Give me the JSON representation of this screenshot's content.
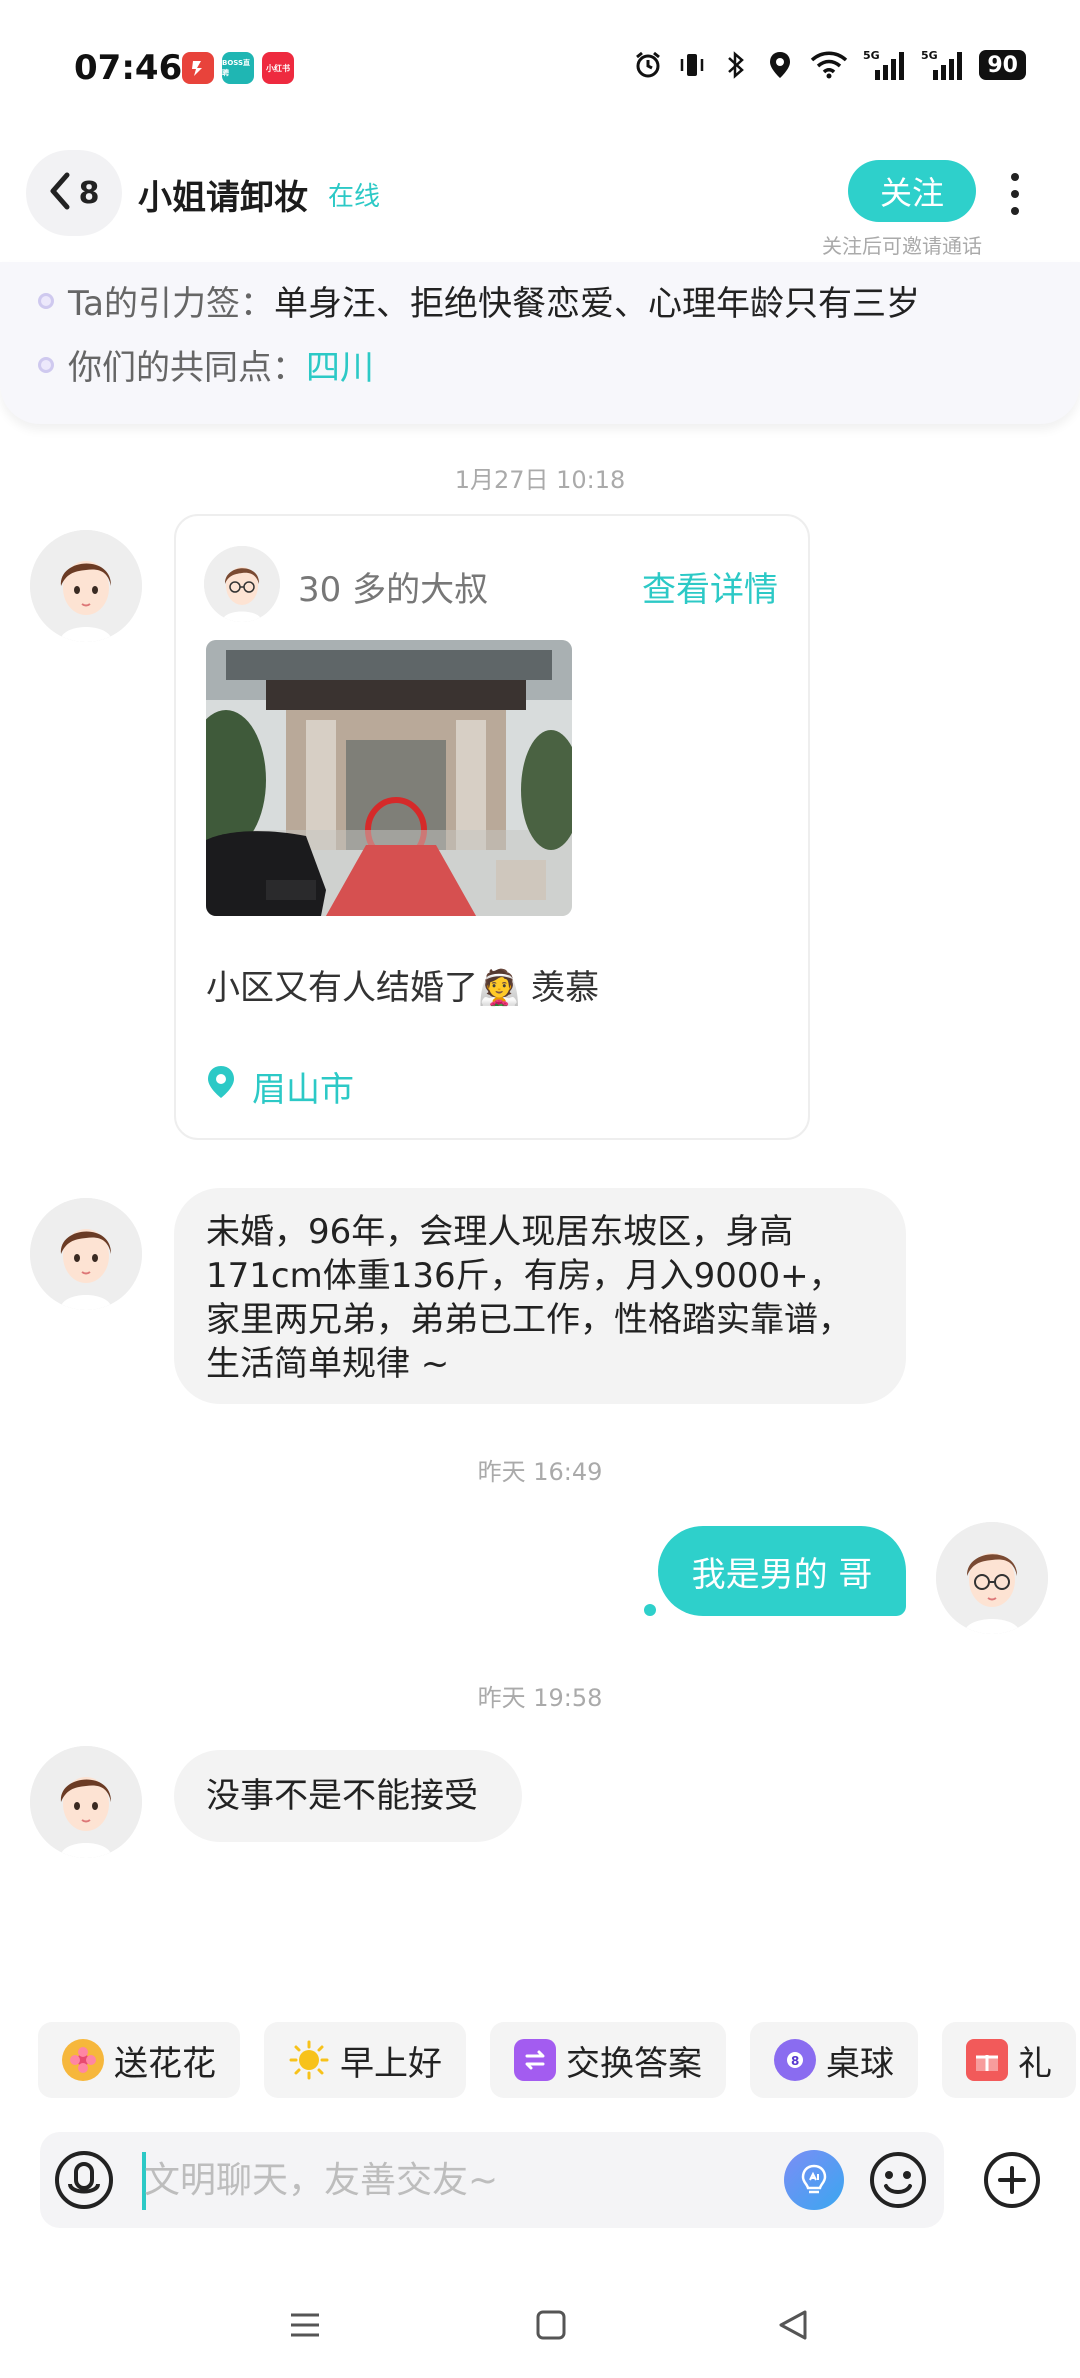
{
  "status_bar": {
    "time": "07:46",
    "apps": [
      {
        "name": "app-badge-1",
        "text": "",
        "color": "#e8433b"
      },
      {
        "name": "app-badge-2",
        "text": "BOSS直聘",
        "color": "#1fb6b3"
      },
      {
        "name": "app-badge-3",
        "text": "小红书",
        "color": "#ee2a3f"
      }
    ],
    "battery": "90"
  },
  "header": {
    "back_count": "8",
    "title": "小姐请卸妆",
    "online": "在线",
    "follow_label": "关注",
    "follow_hint": "关注后可邀请通话"
  },
  "info": {
    "tags_label": "Ta的引力签：",
    "tags_value": "单身汪、拒绝快餐恋爱、心理年龄只有三岁",
    "common_label": "你们的共同点：",
    "common_value": "四川"
  },
  "messages": {
    "ts1": "1月27日 10:18",
    "post": {
      "author": "30 多的大叔",
      "detail_link": "查看详情",
      "text": "小区又有人结婚了👰 羡慕",
      "location": "眉山市"
    },
    "msg1": "未婚，96年，会理人现居东坡区，身高171cm体重136斤，有房，月入9000+，家里两兄弟，弟弟已工作，性格踏实靠谱，生活简单规律 ~",
    "ts2": "昨天 16:49",
    "msg2": "我是男的 哥",
    "ts3": "昨天 19:58",
    "msg3": "没事不是不能接受"
  },
  "chips": [
    {
      "label": "送花花",
      "icon": "flower-icon",
      "color": "#f6b73c"
    },
    {
      "label": "早上好",
      "icon": "sun-icon",
      "color": "#f7c21a"
    },
    {
      "label": "交换答案",
      "icon": "swap-icon",
      "color": "#a35cf0"
    },
    {
      "label": "桌球",
      "icon": "billiard-ball-icon",
      "color": "#8a6cf0"
    },
    {
      "label": "礼",
      "icon": "gift-icon",
      "color": "#f25a5a"
    }
  ],
  "input": {
    "placeholder": "文明聊天，友善交友~"
  }
}
